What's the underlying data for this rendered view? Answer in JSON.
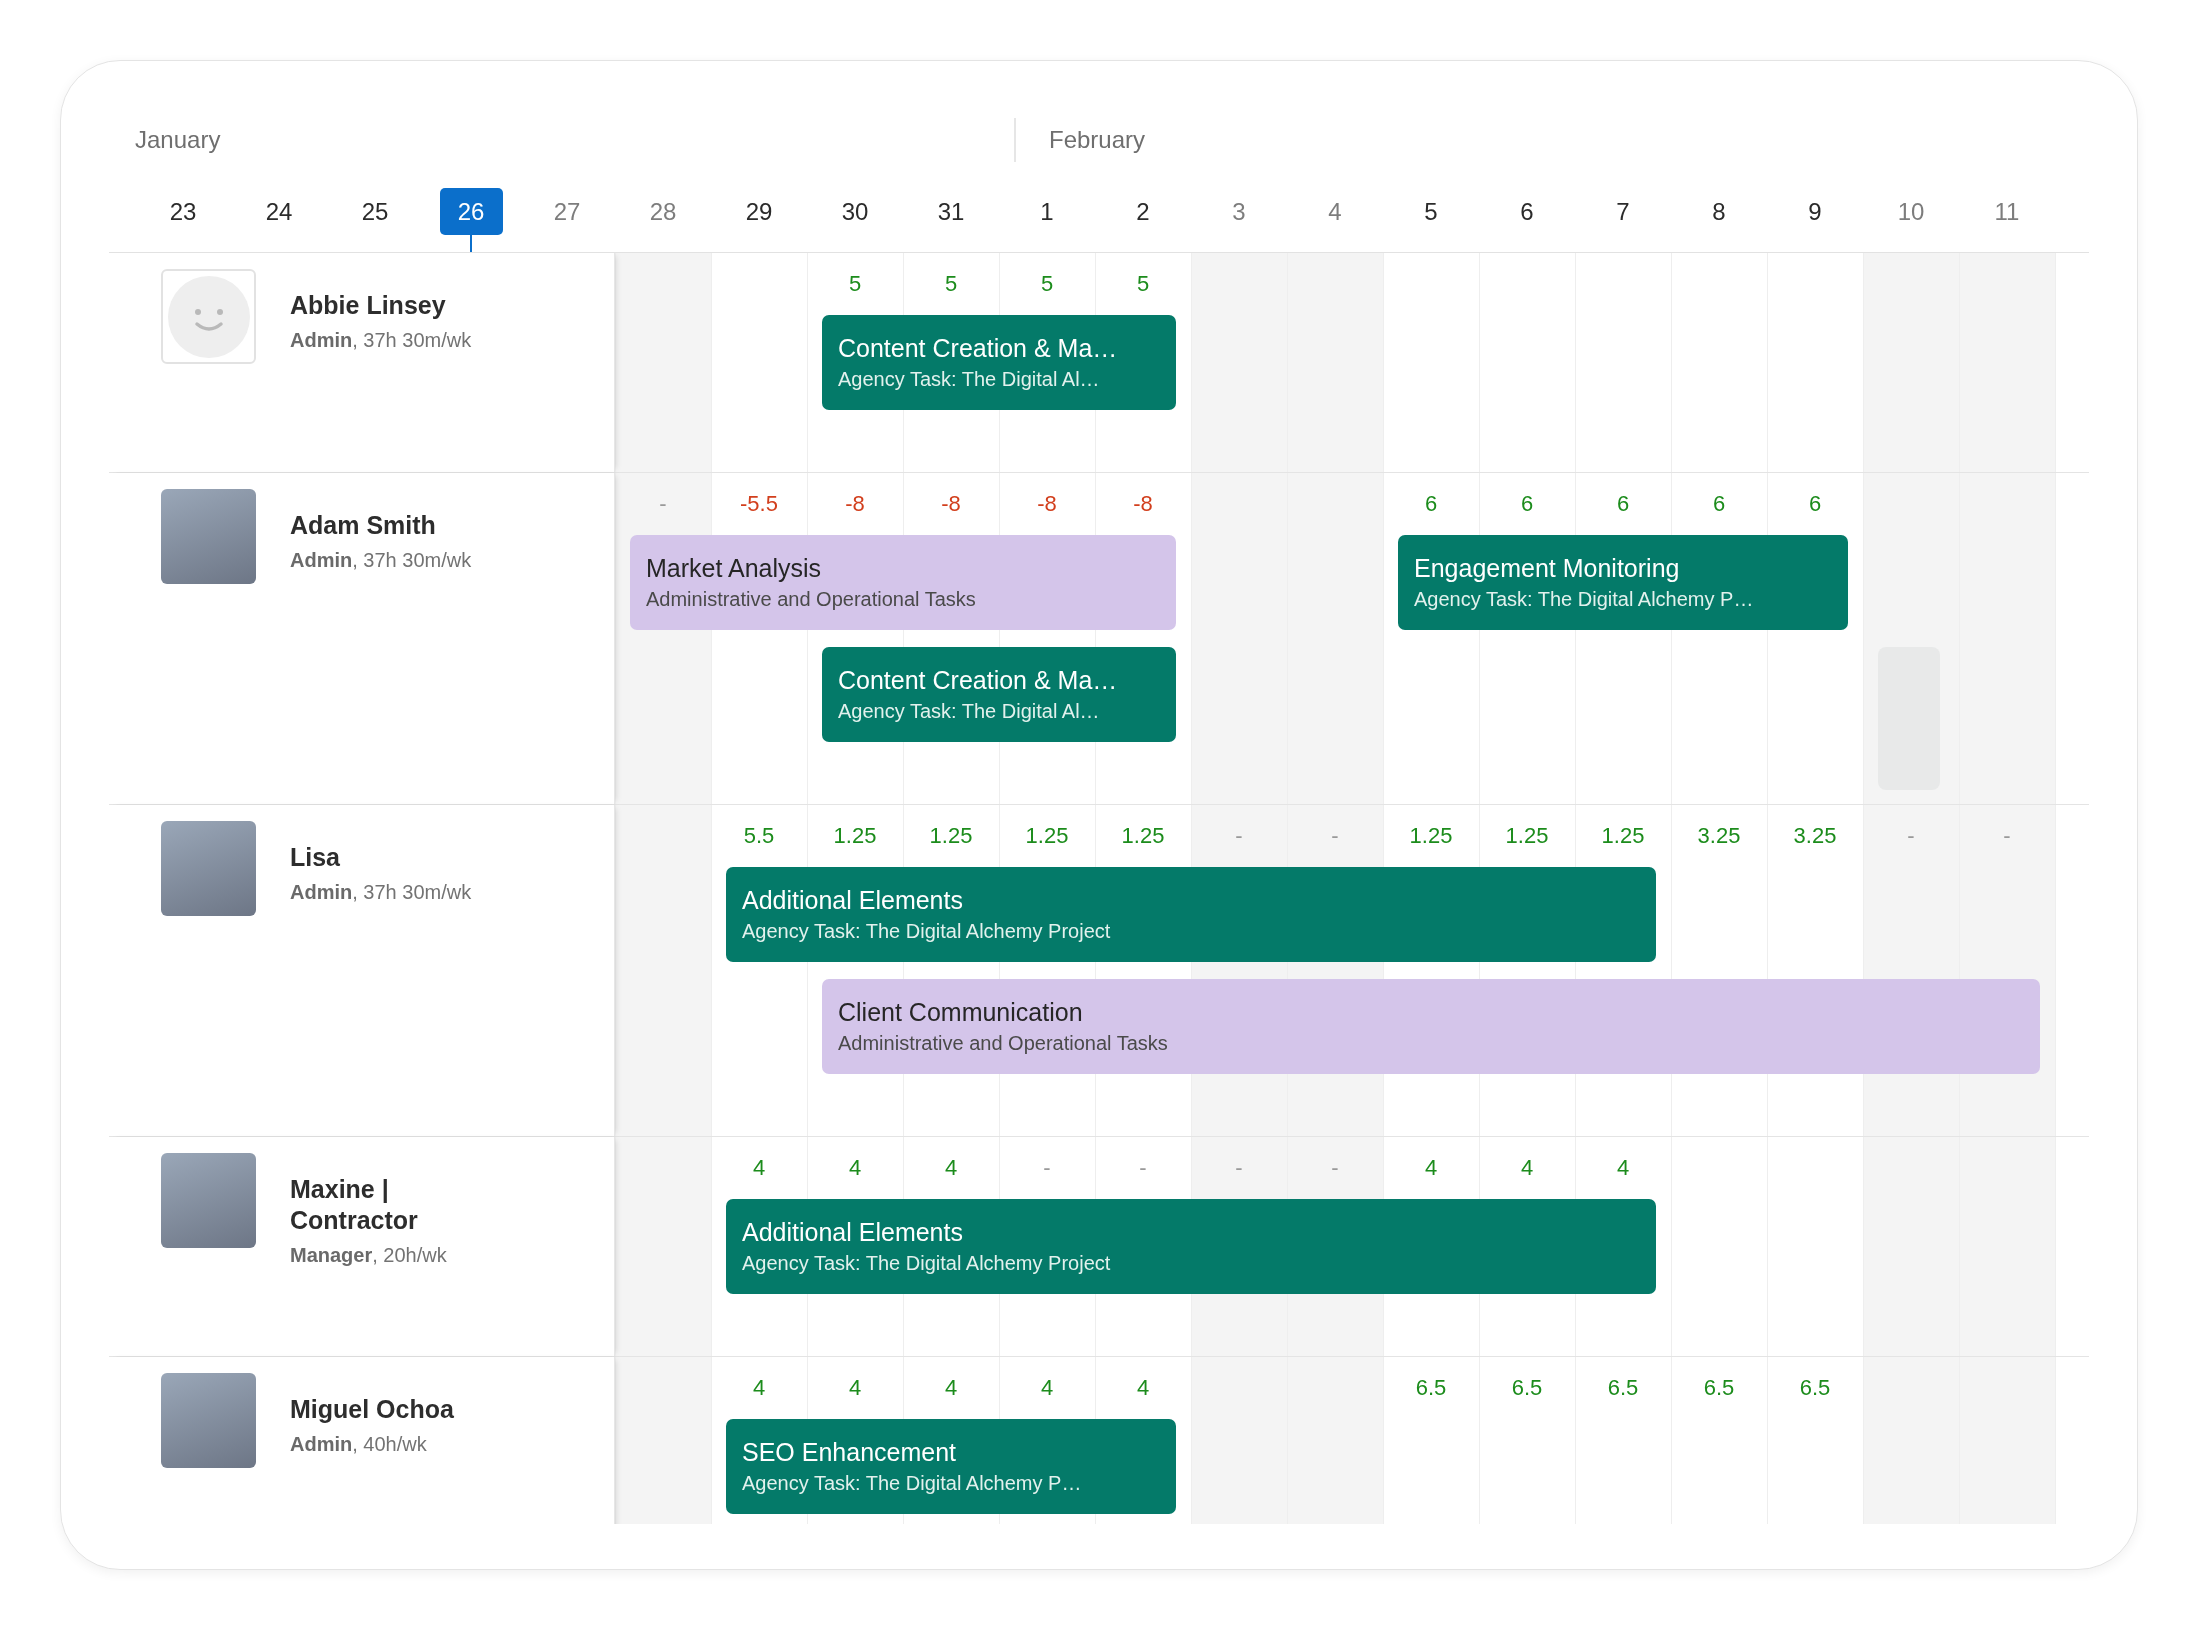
{
  "months": [
    {
      "label": "January",
      "days": [
        {
          "label": "23",
          "weekend": false,
          "selected": false
        },
        {
          "label": "24",
          "weekend": false,
          "selected": false
        },
        {
          "label": "25",
          "weekend": false,
          "selected": false
        },
        {
          "label": "26",
          "weekend": false,
          "selected": true
        },
        {
          "label": "27",
          "weekend": true,
          "selected": false
        },
        {
          "label": "28",
          "weekend": true,
          "selected": false
        },
        {
          "label": "29",
          "weekend": false,
          "selected": false
        },
        {
          "label": "30",
          "weekend": false,
          "selected": false
        },
        {
          "label": "31",
          "weekend": false,
          "selected": false
        }
      ]
    },
    {
      "label": "February",
      "days": [
        {
          "label": "1",
          "weekend": false,
          "selected": false
        },
        {
          "label": "2",
          "weekend": false,
          "selected": false
        },
        {
          "label": "3",
          "weekend": true,
          "selected": false
        },
        {
          "label": "4",
          "weekend": true,
          "selected": false
        },
        {
          "label": "5",
          "weekend": false,
          "selected": false
        },
        {
          "label": "6",
          "weekend": false,
          "selected": false
        },
        {
          "label": "7",
          "weekend": false,
          "selected": false
        },
        {
          "label": "8",
          "weekend": false,
          "selected": false
        },
        {
          "label": "9",
          "weekend": false,
          "selected": false
        },
        {
          "label": "10",
          "weekend": true,
          "selected": false
        },
        {
          "label": "11",
          "weekend": true,
          "selected": false
        }
      ]
    }
  ],
  "people": [
    {
      "name": "Abbie Linsey",
      "role": "**Admin**, 37h 30m/wk",
      "avatar": {
        "kind": "default"
      },
      "hours": [
        {
          "kind": "none"
        },
        {
          "kind": "none"
        },
        {
          "text": "5",
          "kind": "under"
        },
        {
          "text": "5",
          "kind": "under"
        },
        {
          "text": "5",
          "kind": "under"
        },
        {
          "text": "5",
          "kind": "under"
        },
        {
          "kind": "none"
        },
        {
          "kind": "none"
        },
        {
          "kind": "none"
        },
        {
          "kind": "none"
        },
        {
          "kind": "none"
        },
        {
          "kind": "none"
        },
        {
          "kind": "none"
        },
        {
          "kind": "none"
        },
        {
          "kind": "none"
        }
      ],
      "lanes": [
        [
          {
            "kind": "free"
          },
          {
            "kind": "free"
          },
          {
            "kind": "agency",
            "title": "Content Creation & Ma…",
            "subtitle": "Agency Task: The Digital Al…"
          },
          {
            "kind": "cont"
          },
          {
            "kind": "cont"
          },
          {
            "kind": "cont"
          },
          {
            "kind": "free"
          },
          {
            "kind": "free"
          },
          {
            "kind": "free"
          },
          {
            "kind": "free"
          },
          {
            "kind": "free"
          },
          {
            "kind": "free"
          },
          {
            "kind": "free"
          },
          {
            "kind": "free"
          },
          {
            "kind": "free"
          }
        ]
      ]
    },
    {
      "name": "Adam Smith",
      "role": "**Admin**, 37h 30m/wk",
      "avatar": {
        "kind": "photo"
      },
      "hours": [
        {
          "text": "-",
          "kind": "empty"
        },
        {
          "text": "-5.5",
          "kind": "over"
        },
        {
          "text": "-8",
          "kind": "over"
        },
        {
          "text": "-8",
          "kind": "over"
        },
        {
          "text": "-8",
          "kind": "over"
        },
        {
          "text": "-8",
          "kind": "over"
        },
        {
          "kind": "none"
        },
        {
          "kind": "none"
        },
        {
          "text": "6",
          "kind": "under"
        },
        {
          "text": "6",
          "kind": "under"
        },
        {
          "text": "6",
          "kind": "under"
        },
        {
          "text": "6",
          "kind": "under"
        },
        {
          "text": "6",
          "kind": "under"
        },
        {
          "kind": "none"
        },
        {
          "kind": "none"
        }
      ],
      "lanes": [
        [
          {
            "kind": "admin",
            "title": "Market Analysis",
            "subtitle": "Administrative and Operational Tasks"
          },
          {
            "kind": "cont"
          },
          {
            "kind": "cont"
          },
          {
            "kind": "cont"
          },
          {
            "kind": "cont"
          },
          {
            "kind": "cont"
          },
          {
            "kind": "free"
          },
          {
            "kind": "free"
          },
          {
            "kind": "agency",
            "title": "Engagement Monitoring",
            "subtitle": "Agency Task: The Digital Alchemy P…"
          },
          {
            "kind": "cont"
          },
          {
            "kind": "cont"
          },
          {
            "kind": "cont"
          },
          {
            "kind": "cont"
          },
          {
            "kind": "free"
          },
          {
            "kind": "free"
          }
        ],
        [
          {
            "kind": "free"
          },
          {
            "kind": "free"
          },
          {
            "kind": "agency",
            "title": "Content Creation & Ma…",
            "subtitle": "Agency Task: The Digital Al…"
          },
          {
            "kind": "cont"
          },
          {
            "kind": "cont"
          },
          {
            "kind": "cont"
          },
          {
            "kind": "free"
          },
          {
            "kind": "free"
          },
          {
            "kind": "free"
          },
          {
            "kind": "free"
          },
          {
            "kind": "free"
          },
          {
            "kind": "free"
          },
          {
            "kind": "free"
          },
          {
            "kind": "ghost"
          },
          {
            "kind": "free"
          }
        ]
      ]
    },
    {
      "name": "Lisa",
      "role": "**Admin**, 37h 30m/wk",
      "avatar": {
        "kind": "photo"
      },
      "hours": [
        {
          "kind": "none"
        },
        {
          "text": "5.5",
          "kind": "under"
        },
        {
          "text": "1.25",
          "kind": "under"
        },
        {
          "text": "1.25",
          "kind": "under"
        },
        {
          "text": "1.25",
          "kind": "under"
        },
        {
          "text": "1.25",
          "kind": "under"
        },
        {
          "text": "-",
          "kind": "empty"
        },
        {
          "text": "-",
          "kind": "empty"
        },
        {
          "text": "1.25",
          "kind": "under"
        },
        {
          "text": "1.25",
          "kind": "under"
        },
        {
          "text": "1.25",
          "kind": "under"
        },
        {
          "text": "3.25",
          "kind": "under"
        },
        {
          "text": "3.25",
          "kind": "under"
        },
        {
          "text": "-",
          "kind": "empty"
        },
        {
          "text": "-",
          "kind": "empty"
        }
      ],
      "lanes": [
        [
          {
            "kind": "free"
          },
          {
            "kind": "agency",
            "title": "Additional Elements",
            "subtitle": "Agency Task: The Digital Alchemy Project"
          },
          {
            "kind": "cont"
          },
          {
            "kind": "cont"
          },
          {
            "kind": "cont"
          },
          {
            "kind": "cont"
          },
          {
            "kind": "cont"
          },
          {
            "kind": "cont"
          },
          {
            "kind": "cont"
          },
          {
            "kind": "cont"
          },
          {
            "kind": "cont"
          },
          {
            "kind": "free"
          },
          {
            "kind": "free"
          },
          {
            "kind": "free"
          },
          {
            "kind": "free"
          }
        ],
        [
          {
            "kind": "free"
          },
          {
            "kind": "free"
          },
          {
            "kind": "admin",
            "title": "Client Communication",
            "subtitle": "Administrative and Operational Tasks"
          },
          {
            "kind": "cont"
          },
          {
            "kind": "cont"
          },
          {
            "kind": "cont"
          },
          {
            "kind": "cont"
          },
          {
            "kind": "cont"
          },
          {
            "kind": "cont"
          },
          {
            "kind": "cont"
          },
          {
            "kind": "cont"
          },
          {
            "kind": "cont"
          },
          {
            "kind": "cont"
          },
          {
            "kind": "cont"
          },
          {
            "kind": "cont"
          }
        ]
      ]
    },
    {
      "name": "Maxine | Contractor",
      "role": "**Manager**, 20h/wk",
      "avatar": {
        "kind": "photo"
      },
      "hours": [
        {
          "kind": "none"
        },
        {
          "text": "4",
          "kind": "under"
        },
        {
          "text": "4",
          "kind": "under"
        },
        {
          "text": "4",
          "kind": "under"
        },
        {
          "text": "-",
          "kind": "empty"
        },
        {
          "text": "-",
          "kind": "empty"
        },
        {
          "text": "-",
          "kind": "empty"
        },
        {
          "text": "-",
          "kind": "empty"
        },
        {
          "text": "4",
          "kind": "under"
        },
        {
          "text": "4",
          "kind": "under"
        },
        {
          "text": "4",
          "kind": "under"
        },
        {
          "kind": "none"
        },
        {
          "kind": "none"
        },
        {
          "kind": "none"
        },
        {
          "kind": "none"
        }
      ],
      "lanes": [
        [
          {
            "kind": "free"
          },
          {
            "kind": "agency",
            "title": "Additional Elements",
            "subtitle": "Agency Task: The Digital Alchemy Project"
          },
          {
            "kind": "cont"
          },
          {
            "kind": "cont"
          },
          {
            "kind": "cont"
          },
          {
            "kind": "cont"
          },
          {
            "kind": "cont"
          },
          {
            "kind": "cont"
          },
          {
            "kind": "cont"
          },
          {
            "kind": "cont"
          },
          {
            "kind": "cont"
          },
          {
            "kind": "free"
          },
          {
            "kind": "free"
          },
          {
            "kind": "free"
          },
          {
            "kind": "free"
          }
        ]
      ]
    },
    {
      "name": "Miguel Ochoa",
      "role": "**Admin**, 40h/wk",
      "avatar": {
        "kind": "photo"
      },
      "hours": [
        {
          "kind": "none"
        },
        {
          "text": "4",
          "kind": "under"
        },
        {
          "text": "4",
          "kind": "under"
        },
        {
          "text": "4",
          "kind": "under"
        },
        {
          "text": "4",
          "kind": "under"
        },
        {
          "text": "4",
          "kind": "under"
        },
        {
          "kind": "none"
        },
        {
          "kind": "none"
        },
        {
          "text": "6.5",
          "kind": "under"
        },
        {
          "text": "6.5",
          "kind": "under"
        },
        {
          "text": "6.5",
          "kind": "under"
        },
        {
          "text": "6.5",
          "kind": "under"
        },
        {
          "text": "6.5",
          "kind": "under"
        },
        {
          "kind": "none"
        },
        {
          "kind": "none"
        }
      ],
      "lanes": [
        [
          {
            "kind": "free"
          },
          {
            "kind": "agency",
            "title": "SEO Enhancement",
            "subtitle": "Agency Task: The Digital Alchemy P…"
          },
          {
            "kind": "cont"
          },
          {
            "kind": "cont"
          },
          {
            "kind": "cont"
          },
          {
            "kind": "cont"
          },
          {
            "kind": "free"
          },
          {
            "kind": "free"
          },
          {
            "kind": "free"
          },
          {
            "kind": "free"
          },
          {
            "kind": "free"
          },
          {
            "kind": "free"
          },
          {
            "kind": "free"
          },
          {
            "kind": "free"
          },
          {
            "kind": "free"
          }
        ]
      ]
    }
  ]
}
